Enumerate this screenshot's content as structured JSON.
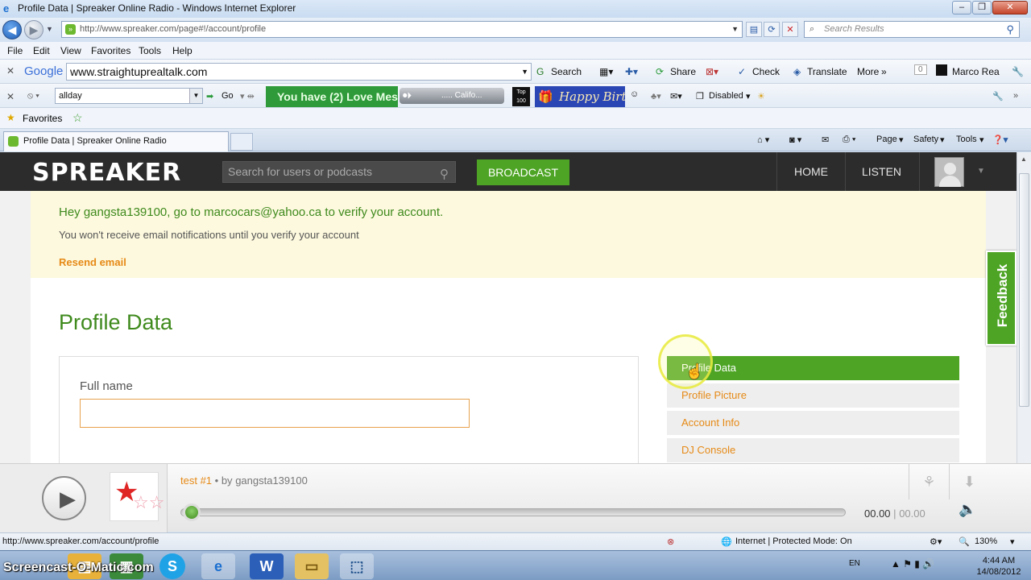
{
  "window": {
    "title": "Profile Data | Spreaker Online Radio - Windows Internet Explorer",
    "url": "http://www.spreaker.com/page#!/account/profile",
    "search_placeholder": "Search Results"
  },
  "menu": [
    "File",
    "Edit",
    "View",
    "Favorites",
    "Tools",
    "Help"
  ],
  "google_toolbar": {
    "brand": "Google",
    "query": "www.straightuprealtalk.com",
    "items": [
      "Search",
      "Share",
      "Check",
      "Translate",
      "More",
      "0",
      "Marco Rea"
    ]
  },
  "toolbar3": {
    "field_value": "allday",
    "go": "Go",
    "love_banner": "You have (2) Love Mes",
    "radio_label": "..... Califo...",
    "top_badge": "Top 100",
    "birthday_banner": "Happy Birthd",
    "disabled": "Disabled"
  },
  "favorites_bar": {
    "label": "Favorites"
  },
  "tab": {
    "label": "Profile Data | Spreaker Online Radio",
    "commands": [
      "Page",
      "Safety",
      "Tools"
    ]
  },
  "site": {
    "logo": "SPREAKER",
    "search_placeholder": "Search for users or podcasts",
    "broadcast": "BROADCAST",
    "nav": [
      "HOME",
      "LISTEN"
    ]
  },
  "verify": {
    "headline": "Hey gangsta139100, go to marcocars@yahoo.ca to verify your account.",
    "sub": "You won't receive email notifications until you verify your account",
    "resend": "Resend email"
  },
  "profile": {
    "title": "Profile Data",
    "full_name_label": "Full name",
    "full_name_value": ""
  },
  "side_nav": [
    {
      "label": "Profile Data",
      "active": true
    },
    {
      "label": "Profile Picture",
      "active": false
    },
    {
      "label": "Account Info",
      "active": false
    },
    {
      "label": "DJ Console",
      "active": false
    }
  ],
  "feedback": "Feedback",
  "player": {
    "track": "test #1",
    "by_text": "• by",
    "author": "gangsta139100",
    "position": "00.00",
    "separator": "|",
    "duration": "00.00",
    "progress_fraction": 0.0
  },
  "statusbar": {
    "url": "http://www.spreaker.com/account/profile",
    "zone": "Internet | Protected Mode: On",
    "zoom": "130%"
  },
  "taskbar": {
    "watermark": "Screencast-O-Matic.com",
    "lang": "EN",
    "time": "4:44 AM",
    "date": "14/08/2012"
  },
  "colors": {
    "brand_green": "#4ea525",
    "title_green": "#3f8a1d",
    "link_orange": "#e68a17",
    "header_dark": "#2c2c2c",
    "verify_bg": "#fdf9de"
  }
}
